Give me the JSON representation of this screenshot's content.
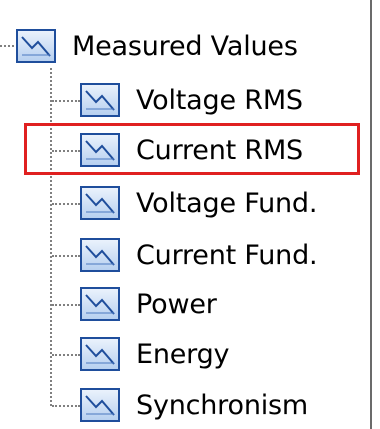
{
  "tree": {
    "root": {
      "label": "Measured Values",
      "icon": "chart-window-icon"
    },
    "children": [
      {
        "label": "Voltage RMS",
        "icon": "chart-window-icon"
      },
      {
        "label": "Current RMS",
        "icon": "chart-window-icon",
        "highlighted": true
      },
      {
        "label": "Voltage Fund.",
        "icon": "chart-window-icon"
      },
      {
        "label": "Current Fund.",
        "icon": "chart-window-icon"
      },
      {
        "label": "Power",
        "icon": "chart-window-icon"
      },
      {
        "label": "Energy",
        "icon": "chart-window-icon"
      },
      {
        "label": "Synchronism",
        "icon": "chart-window-icon"
      }
    ]
  },
  "colors": {
    "highlight_border": "#e02020",
    "icon_border": "#1f4e9c",
    "connector": "#808080"
  }
}
